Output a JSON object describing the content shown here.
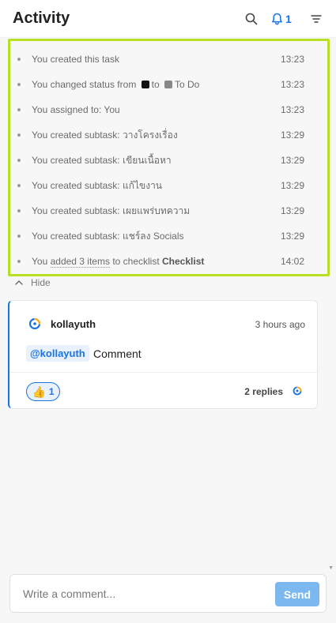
{
  "header": {
    "title": "Activity",
    "notification_count": "1"
  },
  "activity": [
    {
      "parts": [
        {
          "t": "You created this task"
        }
      ],
      "time": "13:23"
    },
    {
      "parts": [
        {
          "t": "You changed status from "
        },
        {
          "swatch": "#111111"
        },
        {
          "t": "to "
        },
        {
          "swatch": "#888888"
        },
        {
          "t": "To Do"
        }
      ],
      "time": "13:23"
    },
    {
      "parts": [
        {
          "t": "You assigned to: You"
        }
      ],
      "time": "13:23"
    },
    {
      "parts": [
        {
          "t": "You created subtask: วางโครงเรื่อง"
        }
      ],
      "time": "13:29"
    },
    {
      "parts": [
        {
          "t": "You created subtask: เขียนเนื้อหา"
        }
      ],
      "time": "13:29"
    },
    {
      "parts": [
        {
          "t": "You created subtask: แก้ไขงาน"
        }
      ],
      "time": "13:29"
    },
    {
      "parts": [
        {
          "t": "You created subtask: เผยแพร่บทความ"
        }
      ],
      "time": "13:29"
    },
    {
      "parts": [
        {
          "t": "You created subtask: แชร์ลง Socials"
        }
      ],
      "time": "13:29"
    },
    {
      "parts": [
        {
          "t": "You "
        },
        {
          "t": "added 3 items",
          "u": true
        },
        {
          "t": " to checklist "
        },
        {
          "t": "Checklist",
          "b": true
        }
      ],
      "time": "14:02"
    }
  ],
  "hide_label": "Hide",
  "comment": {
    "username": "kollayuth",
    "time_ago": "3 hours ago",
    "mention": "@kollayuth",
    "text": "Comment",
    "reaction_emoji": "👍",
    "reaction_count": "1",
    "replies": "2 replies"
  },
  "input": {
    "placeholder": "Write a comment...",
    "send_label": "Send"
  },
  "colors": {
    "accent": "#1a73e8",
    "highlight_border": "#b6e021",
    "send_button": "#7bb8f0"
  }
}
